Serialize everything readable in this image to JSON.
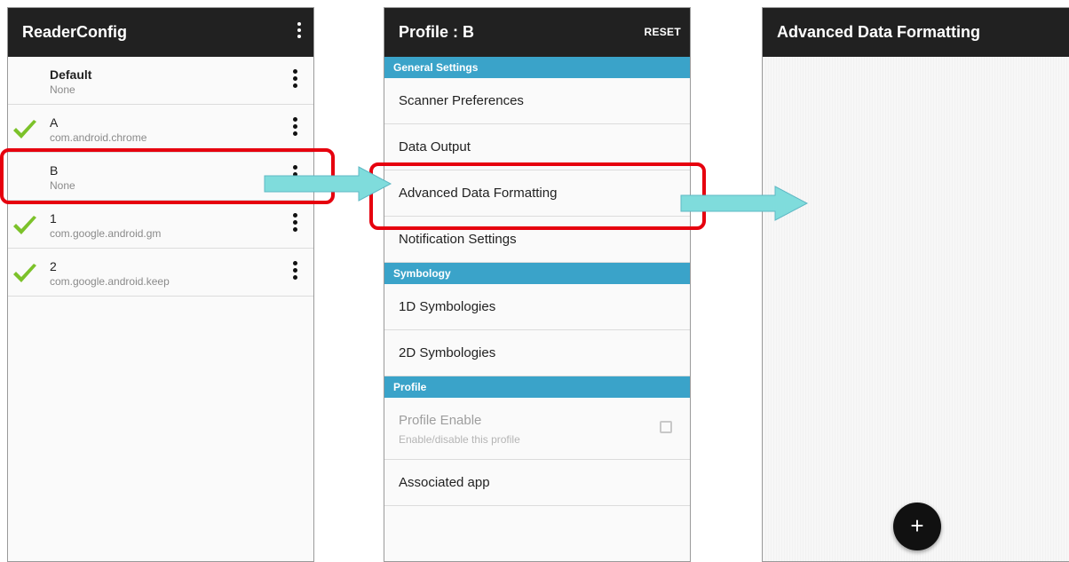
{
  "screen1": {
    "title": "ReaderConfig",
    "profiles": [
      {
        "name": "Default",
        "sub": "None",
        "checked": false
      },
      {
        "name": "A",
        "sub": "com.android.chrome",
        "checked": true
      },
      {
        "name": "B",
        "sub": "None",
        "checked": false
      },
      {
        "name": "1",
        "sub": "com.google.android.gm",
        "checked": true
      },
      {
        "name": "2",
        "sub": "com.google.android.keep",
        "checked": true
      }
    ]
  },
  "screen2": {
    "title": "Profile : B",
    "reset_label": "RESET",
    "sections": {
      "general": "General Settings",
      "symbology": "Symbology",
      "profile": "Profile"
    },
    "items": {
      "scanner_preferences": "Scanner Preferences",
      "data_output": "Data Output",
      "advanced_data_formatting": "Advanced Data Formatting",
      "notification_settings": "Notification Settings",
      "symbologies_1d": "1D Symbologies",
      "symbologies_2d": "2D Symbologies",
      "profile_enable": "Profile Enable",
      "profile_enable_sub": "Enable/disable this profile",
      "associated_app": "Associated app"
    },
    "profile_enabled": false
  },
  "screen3": {
    "title": "Advanced Data Formatting",
    "fab_label": "+"
  },
  "colors": {
    "appbar": "#212121",
    "section_header": "#3aa3c9",
    "highlight": "#e6000e",
    "arrow": "#7fdcdc",
    "check": "#7cc22a"
  }
}
